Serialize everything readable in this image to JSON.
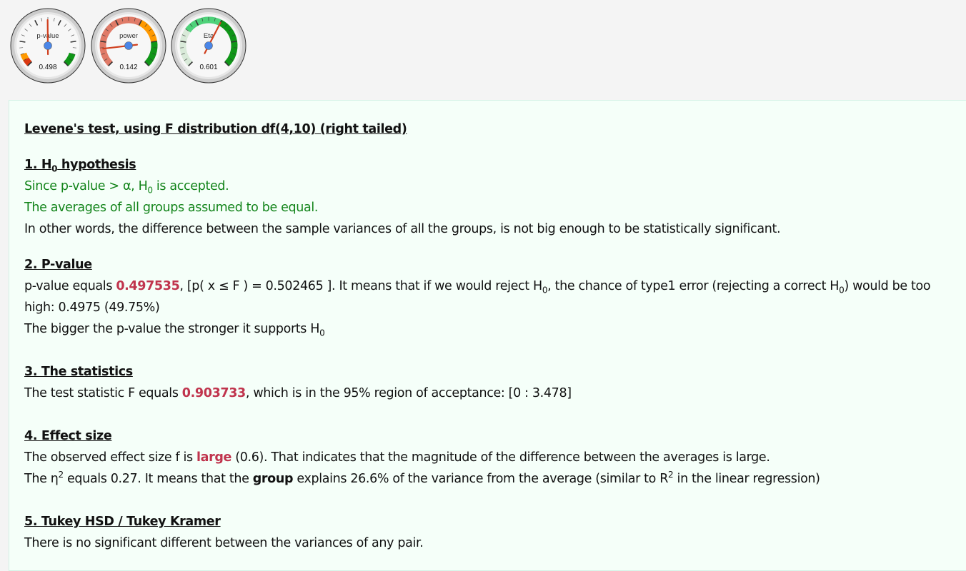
{
  "gauges": [
    {
      "label": "p-value",
      "value": 0.498,
      "display": "0.498",
      "bands": [
        {
          "from": 0,
          "to": 0.05,
          "color": "#dc3912"
        },
        {
          "from": 0.05,
          "to": 0.1,
          "color": "#ff9900"
        },
        {
          "from": 0.9,
          "to": 1,
          "color": "#109618"
        }
      ],
      "min_label": "0",
      "max_label": "1"
    },
    {
      "label": "power",
      "value": 0.142,
      "display": "0.142",
      "bands": [
        {
          "from": 0,
          "to": 0.6,
          "color": "#e07b68"
        },
        {
          "from": 0.6,
          "to": 0.8,
          "color": "#ff9900"
        },
        {
          "from": 0.8,
          "to": 1,
          "color": "#109618"
        }
      ],
      "min_label": "0",
      "max_label": "1"
    },
    {
      "label": "Eta",
      "value": 0.601,
      "display": "0.601",
      "bands": [
        {
          "from": 0,
          "to": 0.3,
          "color": "#d9ead9"
        },
        {
          "from": 0.3,
          "to": 0.6,
          "color": "#4fd27a"
        },
        {
          "from": 0.6,
          "to": 1,
          "color": "#109618"
        }
      ],
      "min_label": "0",
      "max_label": "1"
    }
  ],
  "report": {
    "title": "Levene's test, using F distribution df(4,10) (right tailed)",
    "s1": {
      "h_pre": "1. H",
      "h_sub": "0",
      "h_post": " hypothesis",
      "l1_pre": "Since p-value > α, H",
      "l1_sub": "0",
      "l1_post": " is accepted.",
      "l2": "The averages of all groups assumed to be equal.",
      "l3": "In other words, the difference between the sample variances of all the groups, is not big enough to be statistically significant."
    },
    "s2": {
      "h": "2. P-value",
      "a": "p-value equals ",
      "pval": "0.497535",
      "b": ", [p( x ≤ F ) = 0.502465 ]. It means that if we would reject H",
      "sub1": "0",
      "c": ", the chance of type1 error (rejecting a correct H",
      "sub2": "0",
      "d": ") would be too high: 0.4975 (49.75%)",
      "l2": "The bigger the p-value the stronger it supports H",
      "l2_sub": "0"
    },
    "s3": {
      "h": "3. The statistics",
      "a": "The test statistic F equals ",
      "f": "0.903733",
      "b": ", which is in the 95% region of acceptance: [0 : 3.478]"
    },
    "s4": {
      "h": "4. Effect size",
      "a": "The observed effect size f is ",
      "size": "large",
      "b": " (0.6). That indicates that the magnitude of the difference between the averages is large.",
      "c": "The η",
      "c_sup": "2",
      "d": " equals 0.27. It means that the ",
      "group": "group",
      "e": " explains 26.6% of the variance from the average (similar to R",
      "e_sup": "2",
      "f": " in the linear regression)"
    },
    "s5": {
      "h": "5. Tukey HSD / Tukey Kramer",
      "l1": "There is no significant different between the variances of any pair."
    }
  }
}
